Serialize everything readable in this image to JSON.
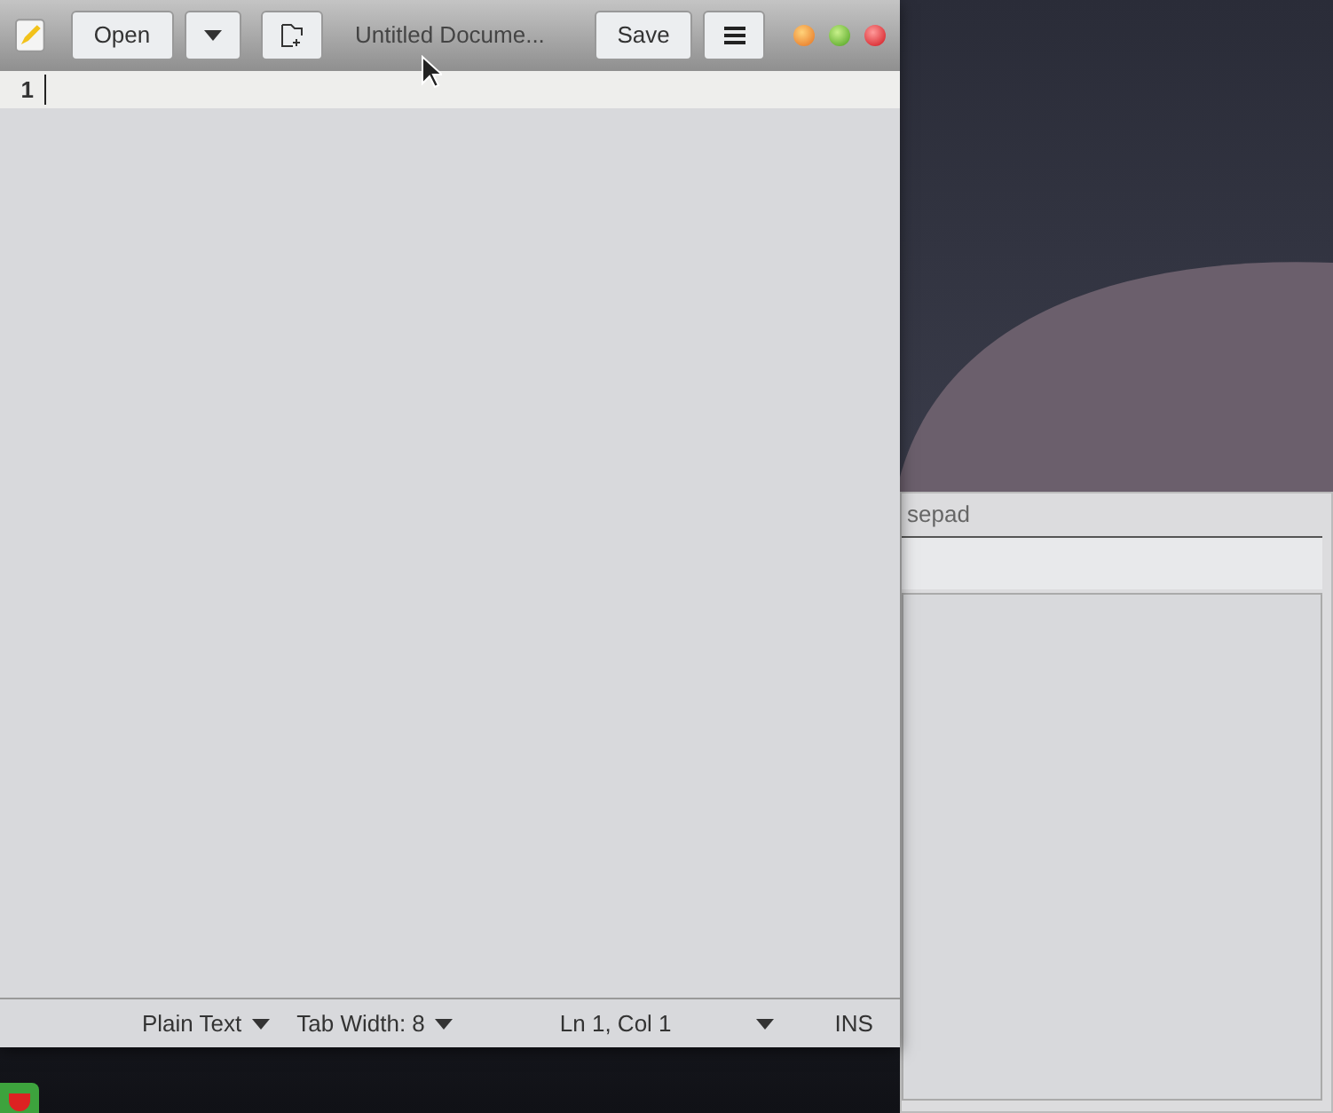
{
  "background_window": {
    "title": "sepad"
  },
  "editor_window": {
    "title": "Untitled Docume...",
    "open_button": "Open",
    "save_button": "Save",
    "line_numbers": [
      "1"
    ],
    "status_bar": {
      "language": "Plain Text",
      "tab_width": "Tab Width: 8",
      "position": "Ln 1, Col 1",
      "mode": "INS"
    }
  }
}
